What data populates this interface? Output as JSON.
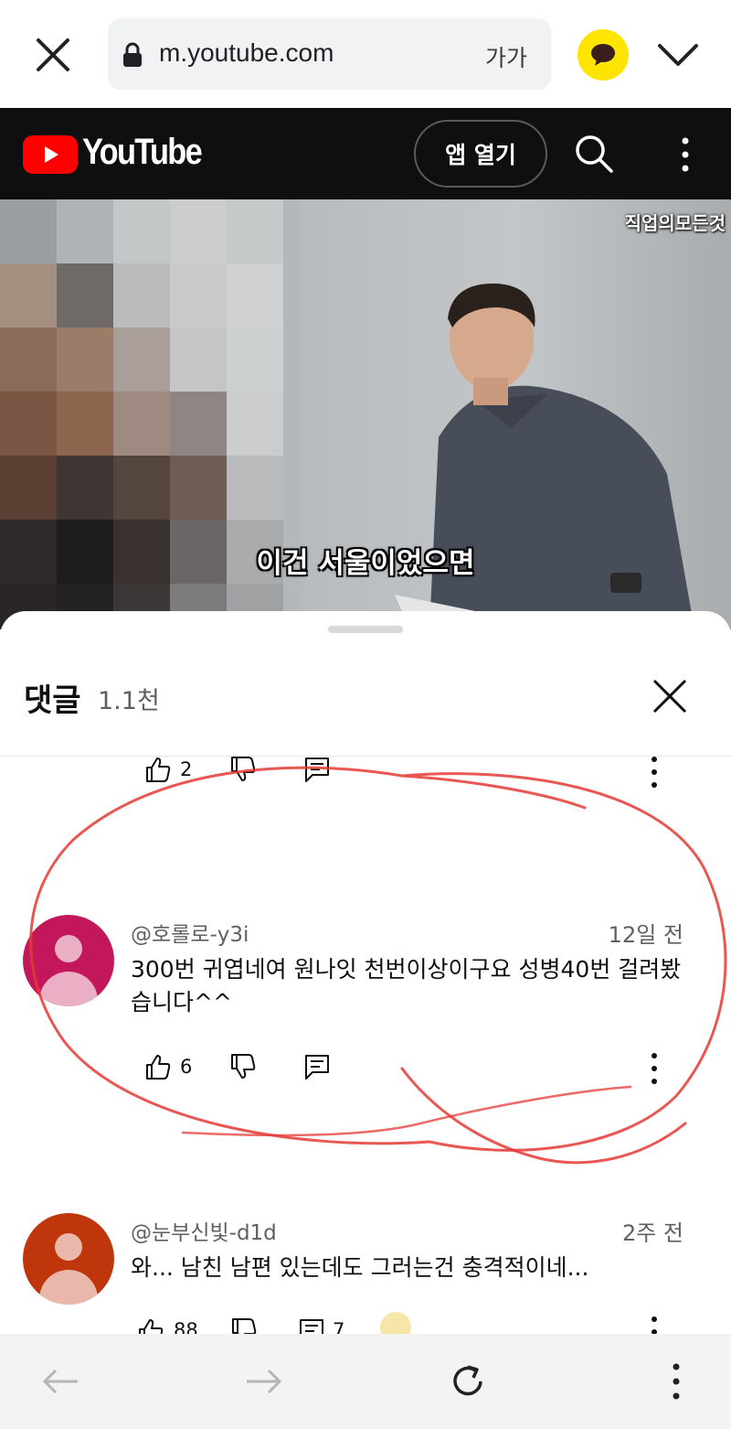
{
  "browser": {
    "url": "m.youtube.com",
    "text_size_label": "가가",
    "accent_kakao": "#fee500"
  },
  "youtube": {
    "wordmark": "YouTube",
    "open_app_label": "앱 열기",
    "brand_red": "#ff0000"
  },
  "video": {
    "channel_watermark": "직업의모든것",
    "subtitle": "이건 서울이었으면"
  },
  "comments_panel": {
    "title": "댓글",
    "count": "1.1천",
    "previous_comment": {
      "likes": "2"
    },
    "comments": [
      {
        "handle": "@호롤로-y3i",
        "time": "12일 전",
        "text": "300번 귀엽네여 원나잇 천번이상이구요 성병40번 걸려봤습니다^^",
        "likes": "6",
        "avatar_color": "#c2185b"
      },
      {
        "handle": "@눈부신빛-d1d",
        "time": "2주 전",
        "text": "와... 남친 남편 있는데도 그러는건 충격적이네...",
        "likes": "88",
        "replies": "7",
        "avatar_color": "#bf360c"
      }
    ]
  },
  "annotation_color": "#e53935"
}
